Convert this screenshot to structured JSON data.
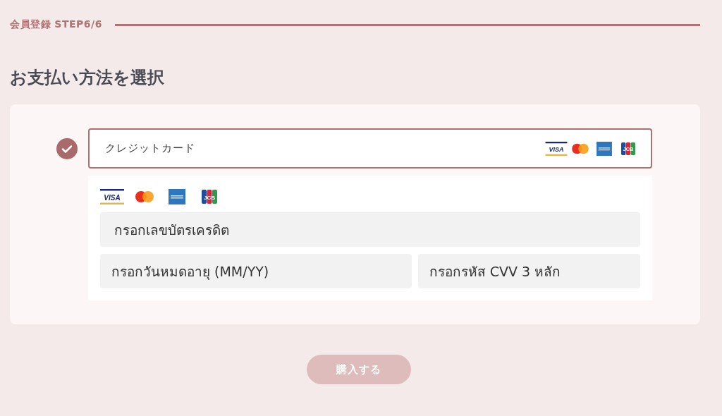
{
  "header": {
    "step_label": "会員登録 STEP6/6"
  },
  "title": "お支払い方法を選択",
  "payment_options": [
    {
      "label": "クレジットカード",
      "selected": true,
      "logos": [
        {
          "kind": "visa",
          "label": "VISA"
        },
        {
          "kind": "mastercard"
        },
        {
          "kind": "amex"
        },
        {
          "kind": "jcb",
          "label": "JCB"
        }
      ]
    }
  ],
  "card_form": {
    "logos": [
      {
        "kind": "visa",
        "label": "VISA"
      },
      {
        "kind": "mastercard"
      },
      {
        "kind": "amex"
      },
      {
        "kind": "jcb",
        "label": "JCB"
      }
    ],
    "card_number": {
      "placeholder": "กรอกเลขบัตรเครดิต"
    },
    "expiry": {
      "placeholder": "กรอกวันหมดอายุ (MM/YY)"
    },
    "cvv": {
      "placeholder": "กรอกรหัส CVV 3 หลัก"
    }
  },
  "submit_button": {
    "label": "購入する",
    "disabled": true
  }
}
